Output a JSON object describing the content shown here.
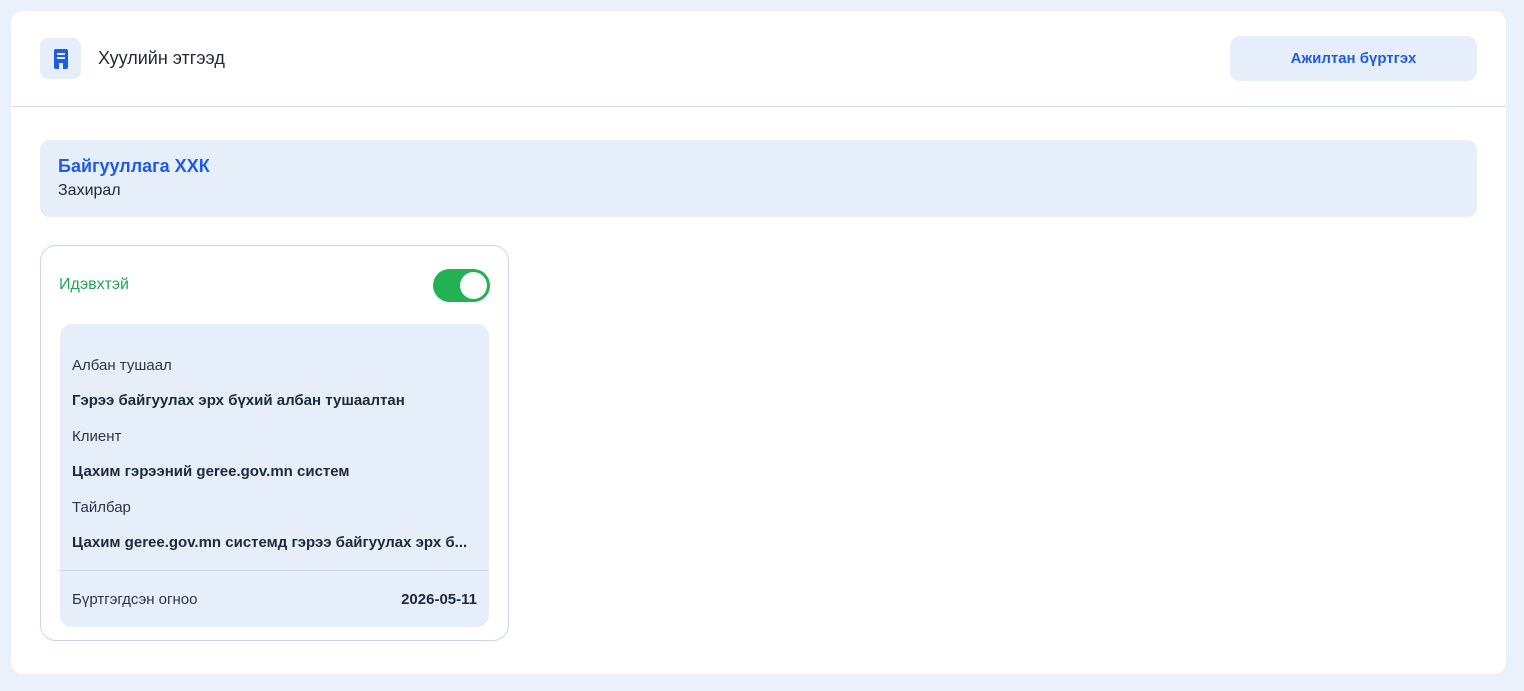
{
  "header": {
    "icon": "building-icon",
    "title": "Хуулийн этгээд",
    "register_button": "Ажилтан бүртгэх"
  },
  "organization": {
    "name": "Байгууллага ХХК",
    "role": "Захирал"
  },
  "card": {
    "status_label": "Идэвхтэй",
    "toggle_on": true,
    "fields": [
      {
        "label": "Албан тушаал",
        "value": "Гэрээ байгуулах эрх бүхий албан тушаалтан"
      },
      {
        "label": "Клиент",
        "value": "Цахим гэрээний geree.gov.mn систем"
      },
      {
        "label": "Тайлбар",
        "value": "Цахим geree.gov.mn системд гэрээ байгуулах эрх б..."
      }
    ],
    "registered_label": "Бүртгэгдсэн огноо",
    "registered_date": "2026-05-11"
  },
  "colors": {
    "accent": "#1f5ce0",
    "active": "#22b154",
    "background": "#eaf1fa"
  }
}
